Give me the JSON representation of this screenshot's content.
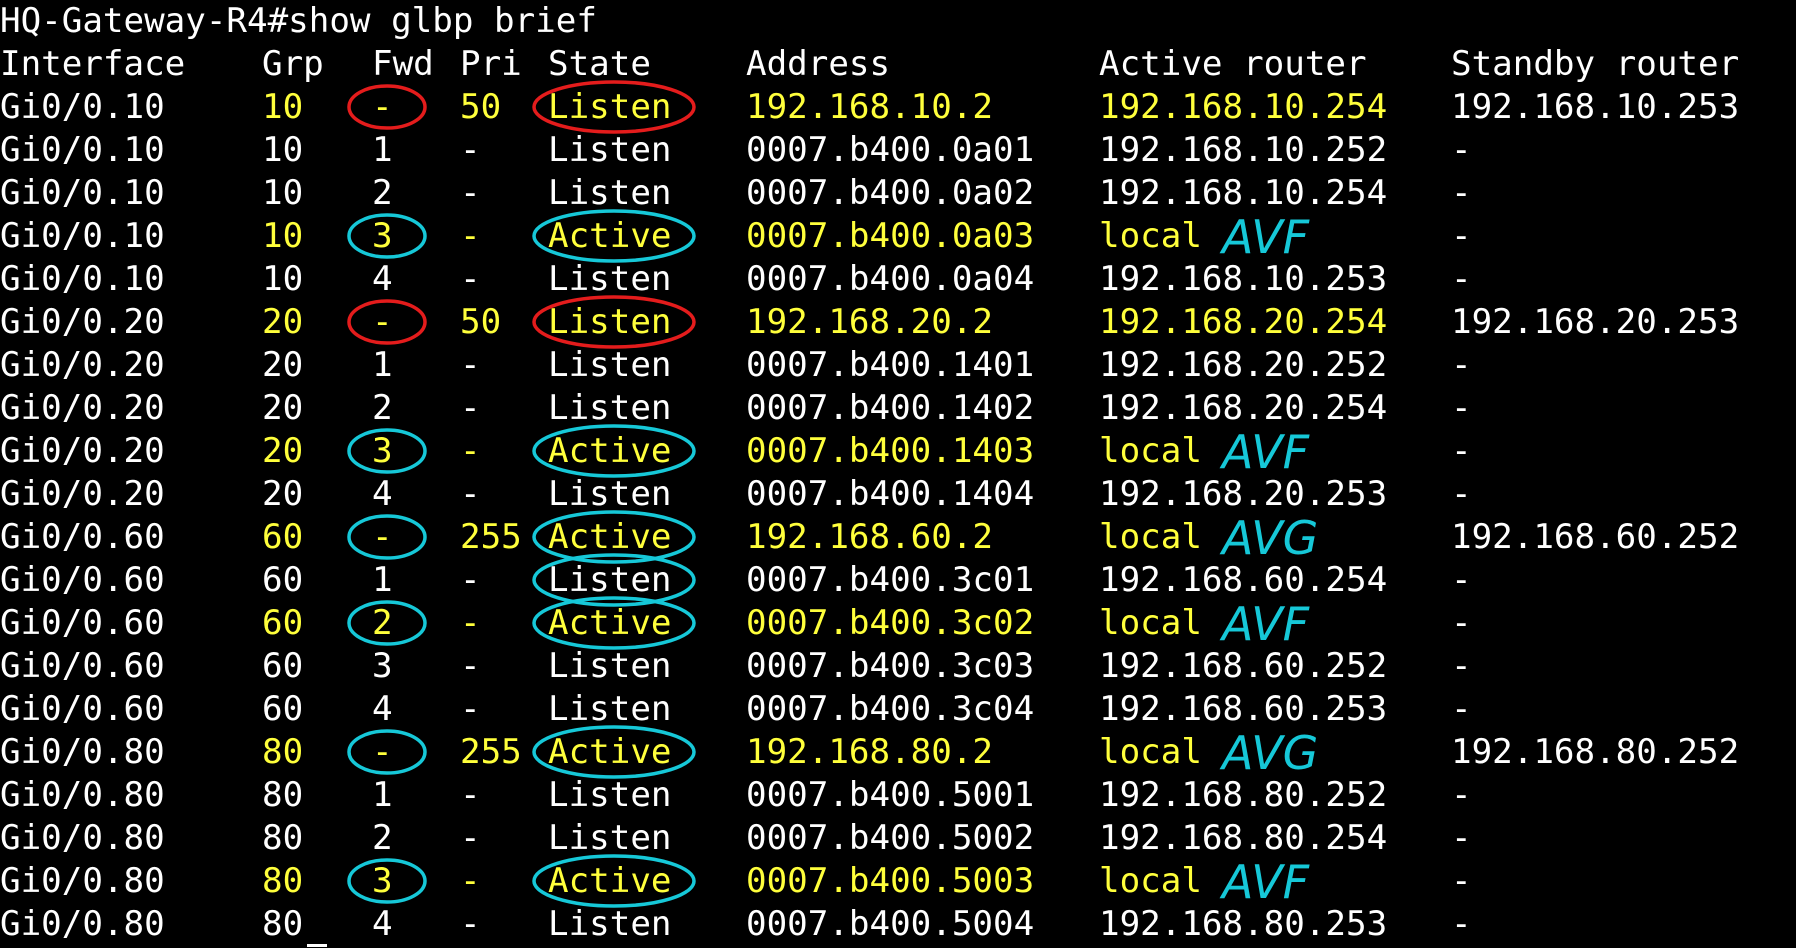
{
  "prompt": "HQ-Gateway-R4#show glbp brief",
  "columns": [
    "Interface",
    "Grp",
    "Fwd",
    "Pri",
    "State",
    "Address",
    "Active router",
    "Standby router"
  ],
  "rows": [
    {
      "if": "Gi0/0.10",
      "grp": "10",
      "fwd": "-",
      "pri": "50",
      "state": "Listen",
      "addr": "192.168.10.2",
      "active": "192.168.10.254",
      "standby": "192.168.10.253",
      "hl": true
    },
    {
      "if": "Gi0/0.10",
      "grp": "10",
      "fwd": "1",
      "pri": "-",
      "state": "Listen",
      "addr": "0007.b400.0a01",
      "active": "192.168.10.252",
      "standby": "-",
      "hl": false
    },
    {
      "if": "Gi0/0.10",
      "grp": "10",
      "fwd": "2",
      "pri": "-",
      "state": "Listen",
      "addr": "0007.b400.0a02",
      "active": "192.168.10.254",
      "standby": "-",
      "hl": false
    },
    {
      "if": "Gi0/0.10",
      "grp": "10",
      "fwd": "3",
      "pri": "-",
      "state": "Active",
      "addr": "0007.b400.0a03",
      "active": "local",
      "standby": "-",
      "hl": true
    },
    {
      "if": "Gi0/0.10",
      "grp": "10",
      "fwd": "4",
      "pri": "-",
      "state": "Listen",
      "addr": "0007.b400.0a04",
      "active": "192.168.10.253",
      "standby": "-",
      "hl": false
    },
    {
      "if": "Gi0/0.20",
      "grp": "20",
      "fwd": "-",
      "pri": "50",
      "state": "Listen",
      "addr": "192.168.20.2",
      "active": "192.168.20.254",
      "standby": "192.168.20.253",
      "hl": true
    },
    {
      "if": "Gi0/0.20",
      "grp": "20",
      "fwd": "1",
      "pri": "-",
      "state": "Listen",
      "addr": "0007.b400.1401",
      "active": "192.168.20.252",
      "standby": "-",
      "hl": false
    },
    {
      "if": "Gi0/0.20",
      "grp": "20",
      "fwd": "2",
      "pri": "-",
      "state": "Listen",
      "addr": "0007.b400.1402",
      "active": "192.168.20.254",
      "standby": "-",
      "hl": false
    },
    {
      "if": "Gi0/0.20",
      "grp": "20",
      "fwd": "3",
      "pri": "-",
      "state": "Active",
      "addr": "0007.b400.1403",
      "active": "local",
      "standby": "-",
      "hl": true
    },
    {
      "if": "Gi0/0.20",
      "grp": "20",
      "fwd": "4",
      "pri": "-",
      "state": "Listen",
      "addr": "0007.b400.1404",
      "active": "192.168.20.253",
      "standby": "-",
      "hl": false
    },
    {
      "if": "Gi0/0.60",
      "grp": "60",
      "fwd": "-",
      "pri": "255",
      "state": "Active",
      "addr": "192.168.60.2",
      "active": "local",
      "standby": "192.168.60.252",
      "hl": true
    },
    {
      "if": "Gi0/0.60",
      "grp": "60",
      "fwd": "1",
      "pri": "-",
      "state": "Listen",
      "addr": "0007.b400.3c01",
      "active": "192.168.60.254",
      "standby": "-",
      "hl": false
    },
    {
      "if": "Gi0/0.60",
      "grp": "60",
      "fwd": "2",
      "pri": "-",
      "state": "Active",
      "addr": "0007.b400.3c02",
      "active": "local",
      "standby": "-",
      "hl": true
    },
    {
      "if": "Gi0/0.60",
      "grp": "60",
      "fwd": "3",
      "pri": "-",
      "state": "Listen",
      "addr": "0007.b400.3c03",
      "active": "192.168.60.252",
      "standby": "-",
      "hl": false
    },
    {
      "if": "Gi0/0.60",
      "grp": "60",
      "fwd": "4",
      "pri": "-",
      "state": "Listen",
      "addr": "0007.b400.3c04",
      "active": "192.168.60.253",
      "standby": "-",
      "hl": false
    },
    {
      "if": "Gi0/0.80",
      "grp": "80",
      "fwd": "-",
      "pri": "255",
      "state": "Active",
      "addr": "192.168.80.2",
      "active": "local",
      "standby": "192.168.80.252",
      "hl": true
    },
    {
      "if": "Gi0/0.80",
      "grp": "80",
      "fwd": "1",
      "pri": "-",
      "state": "Listen",
      "addr": "0007.b400.5001",
      "active": "192.168.80.252",
      "standby": "-",
      "hl": false
    },
    {
      "if": "Gi0/0.80",
      "grp": "80",
      "fwd": "2",
      "pri": "-",
      "state": "Listen",
      "addr": "0007.b400.5002",
      "active": "192.168.80.254",
      "standby": "-",
      "hl": false
    },
    {
      "if": "Gi0/0.80",
      "grp": "80",
      "fwd": "3",
      "pri": "-",
      "state": "Active",
      "addr": "0007.b400.5003",
      "active": "local",
      "standby": "-",
      "hl": true
    },
    {
      "if": "Gi0/0.80",
      "grp": "80",
      "fwd": "4",
      "pri": "-",
      "state": "Listen",
      "addr": "0007.b400.5004",
      "active": "192.168.80.253",
      "standby": "-",
      "hl": false
    }
  ],
  "annotations": {
    "colors": {
      "red": "#e41c1c",
      "cyan": "#16c8d8",
      "highlight": "#ffff3b"
    },
    "circles": [
      {
        "row": 0,
        "col": "fwd",
        "color": "red"
      },
      {
        "row": 0,
        "col": "state",
        "color": "red"
      },
      {
        "row": 3,
        "col": "fwd",
        "color": "cyan"
      },
      {
        "row": 3,
        "col": "state",
        "color": "cyan"
      },
      {
        "row": 5,
        "col": "fwd",
        "color": "red"
      },
      {
        "row": 5,
        "col": "state",
        "color": "red"
      },
      {
        "row": 8,
        "col": "fwd",
        "color": "cyan"
      },
      {
        "row": 8,
        "col": "state",
        "color": "cyan"
      },
      {
        "row": 10,
        "col": "fwd",
        "color": "cyan"
      },
      {
        "row": 10,
        "col": "state",
        "color": "cyan"
      },
      {
        "row": 11,
        "col": "state",
        "color": "cyan"
      },
      {
        "row": 12,
        "col": "fwd",
        "color": "cyan"
      },
      {
        "row": 12,
        "col": "state",
        "color": "cyan"
      },
      {
        "row": 15,
        "col": "fwd",
        "color": "cyan"
      },
      {
        "row": 15,
        "col": "state",
        "color": "cyan"
      },
      {
        "row": 18,
        "col": "fwd",
        "color": "cyan"
      },
      {
        "row": 18,
        "col": "state",
        "color": "cyan"
      }
    ],
    "labels": [
      {
        "row": 3,
        "text": "AVF"
      },
      {
        "row": 8,
        "text": "AVF"
      },
      {
        "row": 10,
        "text": "AVG"
      },
      {
        "row": 12,
        "text": "AVF"
      },
      {
        "row": 15,
        "text": "AVG"
      },
      {
        "row": 18,
        "text": "AVF"
      }
    ]
  }
}
